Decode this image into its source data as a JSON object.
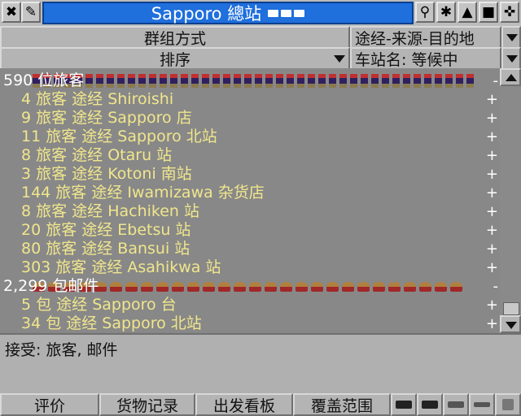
{
  "titlebar": {
    "title": "Sapporo 總站",
    "icons": [
      "close-icon",
      "pencil-icon",
      "vehicle-icons",
      "marker-icon",
      "bug-icon",
      "shade-icon",
      "stop-icon",
      "pin-icon"
    ]
  },
  "controls": {
    "group_label": "群组方式",
    "group_value": "途经-来源-目的地",
    "sort_label": "排序",
    "sort_value": "车站名: 等候中"
  },
  "list": {
    "passenger_header": "590 位旅客",
    "passenger_rows": [
      "4 旅客 途经 Shiroishi",
      "9 旅客 途经 Sapporo 店",
      "11 旅客 途经 Sapporo 北站",
      "8 旅客 途经 Otaru 站",
      "3 旅客 途经 Kotoni 南站",
      "144 旅客 途经 Iwamizawa 杂货店",
      "8 旅客 途经 Hachiken 站",
      "20 旅客 途经 Ebetsu 站",
      "80 旅客 途经 Bansui 站",
      "303 旅客 途经 Asahikwa 站"
    ],
    "mail_header": "2,299 包邮件",
    "mail_rows": [
      "5 包 途经 Sapporo 台",
      "34 包 途经 Sapporo 北站"
    ],
    "collapse_symbol": "-",
    "expand_symbol": "+"
  },
  "status": {
    "accepts": "接受:  旅客, 邮件"
  },
  "tabs": {
    "rating": "评价",
    "goods": "货物记录",
    "departures": "出发看板",
    "coverage": "覆盖范围",
    "vehicle_icons": [
      "train-icon",
      "truck-icon",
      "ship-icon",
      "airplane-icon"
    ]
  },
  "colors": {
    "title_bg": "#1f6fdc",
    "list_bg": "#888888",
    "entry_text": "#f0e68c",
    "header_text": "#ffffff"
  }
}
